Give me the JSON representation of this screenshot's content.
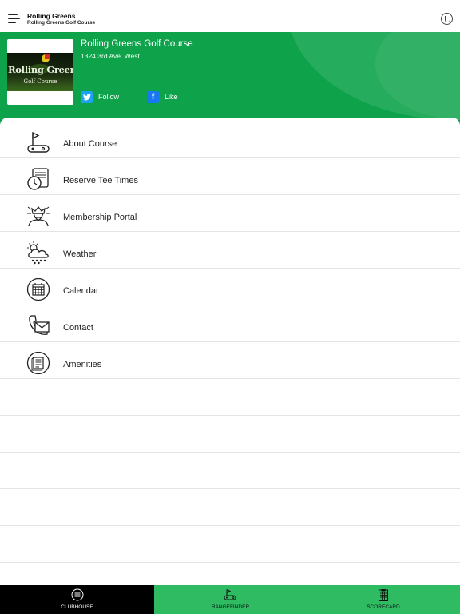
{
  "top_bar": {
    "title": "Rolling Greens",
    "subtitle": "Rolling Greens Golf Course",
    "menu_icon": "hamburger-menu-icon",
    "logo_icon": "club-crest-icon"
  },
  "header": {
    "course_name": "Rolling Greens Golf Course",
    "address": "1324 3rd Ave. West",
    "thumbnail": {
      "name": "Rolling Greens",
      "sub": "Golf Course"
    },
    "social": [
      {
        "label": "Follow",
        "icon": "twitter-icon"
      },
      {
        "label": "Like",
        "icon": "facebook-icon"
      }
    ],
    "accent_color": "#0ea34b"
  },
  "menu": {
    "items": [
      {
        "label": "About Course",
        "icon": "golf-flag-icon"
      },
      {
        "label": "Reserve Tee Times",
        "icon": "tee-time-clock-icon"
      },
      {
        "label": "Membership Portal",
        "icon": "member-crest-icon"
      },
      {
        "label": "Weather",
        "icon": "weather-cloud-icon"
      },
      {
        "label": "Calendar",
        "icon": "calendar-icon"
      },
      {
        "label": "Contact",
        "icon": "phone-mail-icon"
      },
      {
        "label": "Amenities",
        "icon": "amenities-list-icon"
      }
    ]
  },
  "tab_bar": {
    "tabs": [
      {
        "label": "CLUBHOUSE",
        "icon": "clubhouse-menu-icon",
        "active": true
      },
      {
        "label": "RANGEFINDER",
        "icon": "rangefinder-cart-icon",
        "active": false
      },
      {
        "label": "SCORECARD",
        "icon": "scorecard-clipboard-icon",
        "active": false
      }
    ],
    "active_color": "#000000",
    "bar_color": "#2ebb62"
  }
}
